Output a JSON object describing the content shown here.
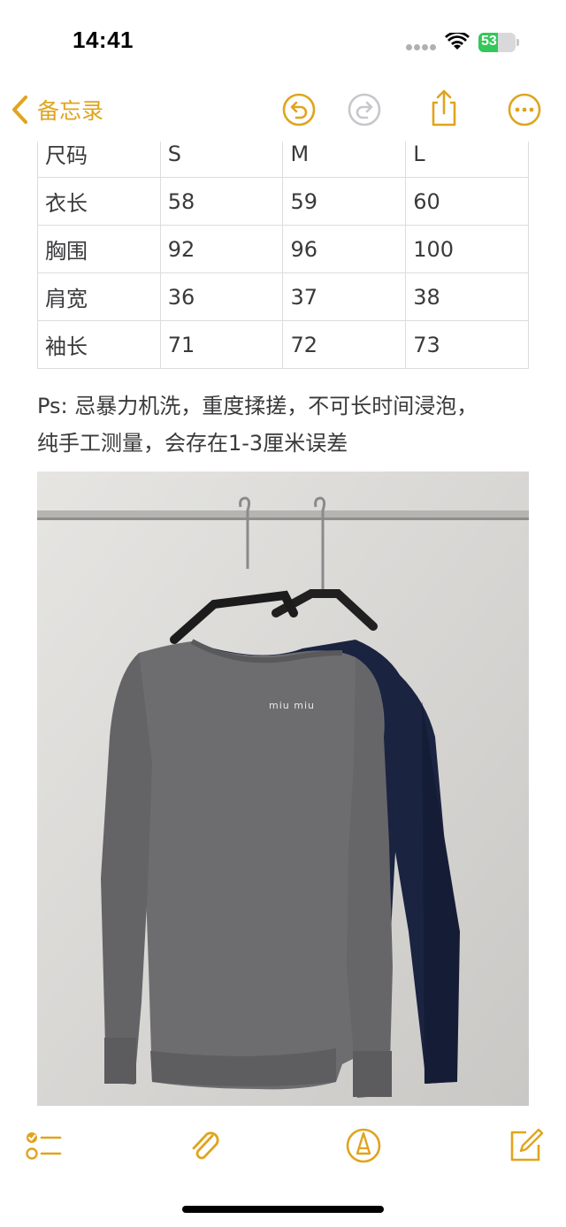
{
  "status_bar": {
    "time": "14:41",
    "battery_level": "53",
    "battery_fraction": 0.53,
    "battery_color": "#34c759"
  },
  "nav": {
    "back_label": "备忘录",
    "accent_color": "#e0a41d",
    "icons": [
      "chevron-left-icon",
      "undo-icon",
      "redo-icon",
      "share-icon",
      "more-icon"
    ]
  },
  "size_table": {
    "rows": [
      [
        "尺码",
        "S",
        "M",
        "L"
      ],
      [
        "衣长",
        "58",
        "59",
        "60"
      ],
      [
        "胸围",
        "92",
        "96",
        "100"
      ],
      [
        "肩宽",
        "36",
        "37",
        "38"
      ],
      [
        "袖长",
        "71",
        "72",
        "73"
      ]
    ]
  },
  "note": {
    "line1": "Ps: 忌暴力机洗，重度揉搓，不可长时间浸泡，",
    "line2": "纯手工测量，会存在1-3厘米误差"
  },
  "photo": {
    "logo_text": "miu miu"
  },
  "toolbar": {
    "icons": [
      "checklist-icon",
      "paperclip-icon",
      "markup-pen-icon",
      "compose-icon"
    ]
  }
}
